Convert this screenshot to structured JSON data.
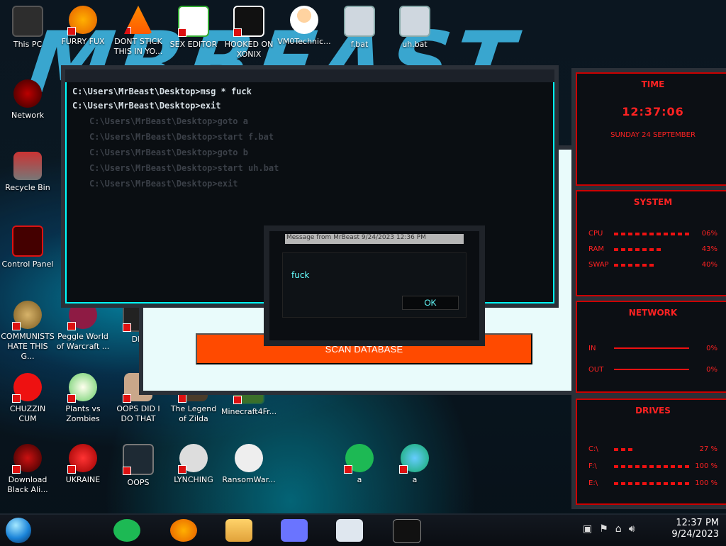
{
  "desktop": {
    "icons": [
      {
        "id": "this-pc",
        "label": "This PC"
      },
      {
        "id": "furry-fux",
        "label": "FURRY FUX"
      },
      {
        "id": "dont-stick",
        "label": "DONT STICK THIS IN YO..."
      },
      {
        "id": "sex-editor",
        "label": "SEX EDITOR"
      },
      {
        "id": "hooked-xonix",
        "label": "HOOKED ON XONIX"
      },
      {
        "id": "vm0",
        "label": "VM0Technic..."
      },
      {
        "id": "f-bat",
        "label": "f.bat"
      },
      {
        "id": "uh-bat",
        "label": "uh.bat"
      },
      {
        "id": "network",
        "label": "Network"
      },
      {
        "id": "recycle",
        "label": "Recycle Bin"
      },
      {
        "id": "control",
        "label": "Control Panel"
      },
      {
        "id": "communists",
        "label": "COMMUNISTS HATE THIS G..."
      },
      {
        "id": "peggle",
        "label": "Peggle World of Warcraft ..."
      },
      {
        "id": "die",
        "label": "DIE"
      },
      {
        "id": "chuzzin",
        "label": "CHUZZIN CUM"
      },
      {
        "id": "pvz",
        "label": "Plants vs Zombies"
      },
      {
        "id": "oops-did",
        "label": "OOPS DID I DO THAT"
      },
      {
        "id": "zilda",
        "label": "The Legend of Zilda"
      },
      {
        "id": "minecraft",
        "label": "Minecraft4Fr..."
      },
      {
        "id": "download",
        "label": "Download Black Ali..."
      },
      {
        "id": "ukraine",
        "label": "UKRAINE"
      },
      {
        "id": "oops",
        "label": "OOPS"
      },
      {
        "id": "lynching",
        "label": "LYNCHING"
      },
      {
        "id": "ransom",
        "label": "RansomWar..."
      },
      {
        "id": "a-icon",
        "label": "a"
      },
      {
        "id": "globe",
        "label": "a"
      }
    ]
  },
  "terminal": {
    "line1": "C:\\Users\\MrBeast\\Desktop>msg * fuck",
    "line2": "C:\\Users\\MrBeast\\Desktop>exit",
    "ghost": [
      "C:\\Users\\MrBeast\\Desktop>goto a",
      "C:\\Users\\MrBeast\\Desktop>start f.bat",
      "C:\\Users\\MrBeast\\Desktop>goto b",
      "C:\\Users\\MrBeast\\Desktop>start uh.bat",
      "C:\\Users\\MrBeast\\Desktop>exit"
    ]
  },
  "app": {
    "scan_label": "SCAN DATABASE"
  },
  "message": {
    "title": "Message from MrBeast 9/24/2023 12:36 PM",
    "text": "fuck",
    "ok_label": "OK"
  },
  "widgets": {
    "time_header": "TIME",
    "time": "12:37:06",
    "date": "SUNDAY 24 SEPTEMBER",
    "system_header": "SYSTEM",
    "system_rows": [
      {
        "label": "CPU",
        "value": "06%"
      },
      {
        "label": "RAM",
        "value": "43%"
      },
      {
        "label": "SWAP",
        "value": "40%"
      }
    ],
    "network_header": "NETWORK",
    "network_rows": [
      {
        "label": "IN",
        "value": "0%"
      },
      {
        "label": "OUT",
        "value": "0%"
      }
    ],
    "drives_header": "DRIVES",
    "drives_rows": [
      {
        "label": "C:\\",
        "value": "27 %"
      },
      {
        "label": "F:\\",
        "value": "100 %"
      },
      {
        "label": "E:\\",
        "value": "100 %"
      }
    ]
  },
  "taskbar": {
    "time": "12:37 PM",
    "date": "9/24/2023"
  }
}
